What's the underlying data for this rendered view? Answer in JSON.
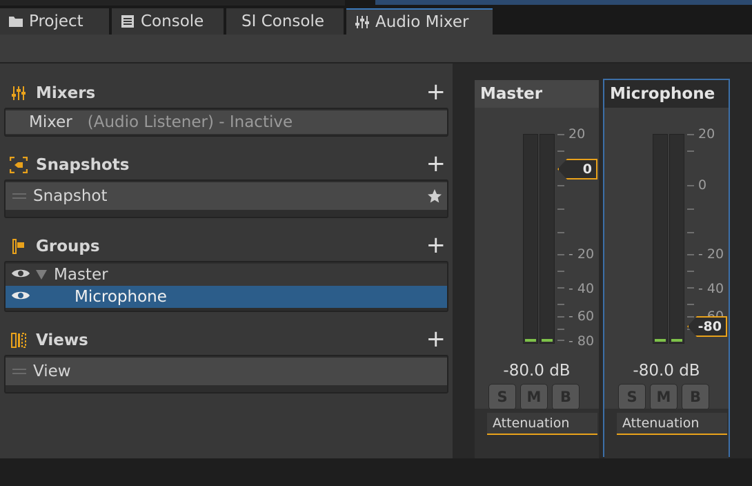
{
  "tabs": [
    {
      "label": "Project",
      "icon": "folder-icon"
    },
    {
      "label": "Console",
      "icon": "console-icon"
    },
    {
      "label": "SI Console",
      "icon": ""
    },
    {
      "label": "Audio Mixer",
      "icon": "mixer-sliders-icon",
      "active": true
    }
  ],
  "sections": {
    "mixers": {
      "title": "Mixers",
      "items": [
        {
          "name": "Mixer",
          "info": "(Audio Listener) - Inactive"
        }
      ]
    },
    "snapshots": {
      "title": "Snapshots",
      "items": [
        {
          "name": "Snapshot",
          "starred": true
        }
      ]
    },
    "groups": {
      "title": "Groups",
      "items": [
        {
          "name": "Master",
          "expanded": true
        },
        {
          "name": "Microphone",
          "selected": true
        }
      ]
    },
    "views": {
      "title": "Views",
      "items": [
        {
          "name": "View"
        }
      ]
    }
  },
  "strips": [
    {
      "name": "Master",
      "level_db": "-80.0 dB",
      "attenuation_db": 0,
      "fader_label": "0",
      "buttons": [
        "S",
        "M",
        "B"
      ],
      "effect": "Attenuation",
      "scale_labels": [
        "20",
        "0",
        "- 20",
        "- 40",
        "- 60",
        "- 80"
      ]
    },
    {
      "name": "Microphone",
      "level_db": "-80.0 dB",
      "attenuation_db": -80,
      "fader_label": "-80",
      "buttons": [
        "S",
        "M",
        "B"
      ],
      "effect": "Attenuation",
      "scale_labels": [
        "20",
        "0",
        "- 20",
        "- 40",
        "- 60",
        "- 80"
      ]
    }
  ],
  "colors": {
    "accent": "#e9a21b",
    "selection": "#2c5d8a",
    "meter": "#7ec24a"
  }
}
